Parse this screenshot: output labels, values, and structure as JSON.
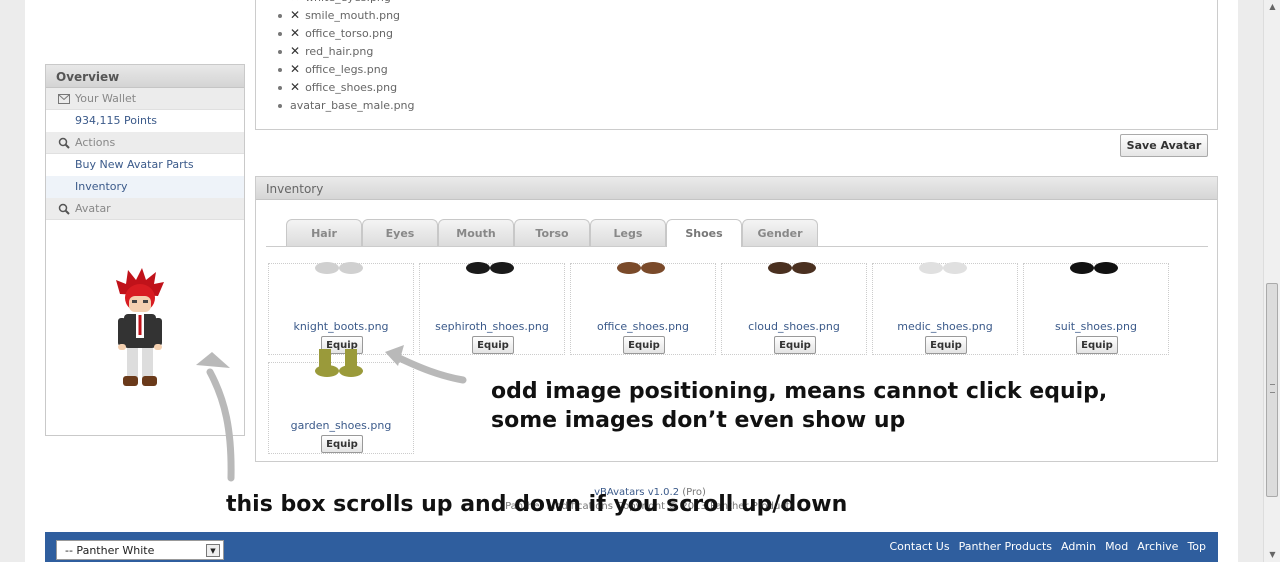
{
  "top_list": {
    "items": [
      {
        "name": "white_eyes.png",
        "removable": true
      },
      {
        "name": "smile_mouth.png",
        "removable": true
      },
      {
        "name": "office_torso.png",
        "removable": true
      },
      {
        "name": "red_hair.png",
        "removable": true
      },
      {
        "name": "office_legs.png",
        "removable": true
      },
      {
        "name": "office_shoes.png",
        "removable": true
      },
      {
        "name": "avatar_base_male.png",
        "removable": false
      }
    ],
    "remove_glyph": "✕"
  },
  "save_button": "Save Avatar",
  "sidebar": {
    "title": "Overview",
    "wallet_label": "Your Wallet",
    "points": "934,115 Points",
    "actions_label": "Actions",
    "buy_parts": "Buy New Avatar Parts",
    "inventory": "Inventory",
    "avatar_label": "Avatar"
  },
  "inventory": {
    "title": "Inventory",
    "tabs": [
      "Hair",
      "Eyes",
      "Mouth",
      "Torso",
      "Legs",
      "Shoes",
      "Gender"
    ],
    "active_tab": "Shoes",
    "equip_label": "Equip",
    "items": [
      {
        "name": "knight_boots.png",
        "color": "#d0d0d0"
      },
      {
        "name": "sephiroth_shoes.png",
        "color": "#1a1a1a"
      },
      {
        "name": "office_shoes.png",
        "color": "#7a4a2a"
      },
      {
        "name": "cloud_shoes.png",
        "color": "#4a3020"
      },
      {
        "name": "medic_shoes.png",
        "color": "#e0e0e0"
      },
      {
        "name": "suit_shoes.png",
        "color": "#111111"
      },
      {
        "name": "garden_shoes.png",
        "color": "#9a9a3a"
      }
    ]
  },
  "annotations": {
    "line1": "odd image positioning, means cannot click equip,",
    "line2": "some images don’t even show up",
    "line3": "this box scrolls up and down if you scroll up/down"
  },
  "footer": {
    "product": "vBAvatars v1.0.2",
    "product_suffix": " (Pro)",
    "copyright": "Panther Modifications Copyright © 2013 Panther Products"
  },
  "navbar": {
    "style_select": "-- Panther White",
    "links": [
      "Contact Us",
      "Panther Products",
      "Admin",
      "Mod",
      "Archive",
      "Top"
    ]
  }
}
